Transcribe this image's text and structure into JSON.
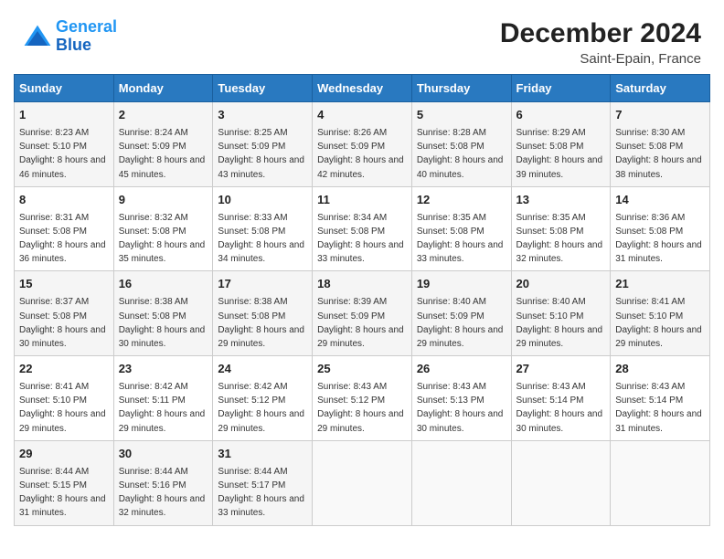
{
  "header": {
    "logo_line1": "General",
    "logo_line2": "Blue",
    "month_year": "December 2024",
    "location": "Saint-Epain, France"
  },
  "weekdays": [
    "Sunday",
    "Monday",
    "Tuesday",
    "Wednesday",
    "Thursday",
    "Friday",
    "Saturday"
  ],
  "weeks": [
    [
      {
        "day": "1",
        "sunrise": "Sunrise: 8:23 AM",
        "sunset": "Sunset: 5:10 PM",
        "daylight": "Daylight: 8 hours and 46 minutes."
      },
      {
        "day": "2",
        "sunrise": "Sunrise: 8:24 AM",
        "sunset": "Sunset: 5:09 PM",
        "daylight": "Daylight: 8 hours and 45 minutes."
      },
      {
        "day": "3",
        "sunrise": "Sunrise: 8:25 AM",
        "sunset": "Sunset: 5:09 PM",
        "daylight": "Daylight: 8 hours and 43 minutes."
      },
      {
        "day": "4",
        "sunrise": "Sunrise: 8:26 AM",
        "sunset": "Sunset: 5:09 PM",
        "daylight": "Daylight: 8 hours and 42 minutes."
      },
      {
        "day": "5",
        "sunrise": "Sunrise: 8:28 AM",
        "sunset": "Sunset: 5:08 PM",
        "daylight": "Daylight: 8 hours and 40 minutes."
      },
      {
        "day": "6",
        "sunrise": "Sunrise: 8:29 AM",
        "sunset": "Sunset: 5:08 PM",
        "daylight": "Daylight: 8 hours and 39 minutes."
      },
      {
        "day": "7",
        "sunrise": "Sunrise: 8:30 AM",
        "sunset": "Sunset: 5:08 PM",
        "daylight": "Daylight: 8 hours and 38 minutes."
      }
    ],
    [
      {
        "day": "8",
        "sunrise": "Sunrise: 8:31 AM",
        "sunset": "Sunset: 5:08 PM",
        "daylight": "Daylight: 8 hours and 36 minutes."
      },
      {
        "day": "9",
        "sunrise": "Sunrise: 8:32 AM",
        "sunset": "Sunset: 5:08 PM",
        "daylight": "Daylight: 8 hours and 35 minutes."
      },
      {
        "day": "10",
        "sunrise": "Sunrise: 8:33 AM",
        "sunset": "Sunset: 5:08 PM",
        "daylight": "Daylight: 8 hours and 34 minutes."
      },
      {
        "day": "11",
        "sunrise": "Sunrise: 8:34 AM",
        "sunset": "Sunset: 5:08 PM",
        "daylight": "Daylight: 8 hours and 33 minutes."
      },
      {
        "day": "12",
        "sunrise": "Sunrise: 8:35 AM",
        "sunset": "Sunset: 5:08 PM",
        "daylight": "Daylight: 8 hours and 33 minutes."
      },
      {
        "day": "13",
        "sunrise": "Sunrise: 8:35 AM",
        "sunset": "Sunset: 5:08 PM",
        "daylight": "Daylight: 8 hours and 32 minutes."
      },
      {
        "day": "14",
        "sunrise": "Sunrise: 8:36 AM",
        "sunset": "Sunset: 5:08 PM",
        "daylight": "Daylight: 8 hours and 31 minutes."
      }
    ],
    [
      {
        "day": "15",
        "sunrise": "Sunrise: 8:37 AM",
        "sunset": "Sunset: 5:08 PM",
        "daylight": "Daylight: 8 hours and 30 minutes."
      },
      {
        "day": "16",
        "sunrise": "Sunrise: 8:38 AM",
        "sunset": "Sunset: 5:08 PM",
        "daylight": "Daylight: 8 hours and 30 minutes."
      },
      {
        "day": "17",
        "sunrise": "Sunrise: 8:38 AM",
        "sunset": "Sunset: 5:08 PM",
        "daylight": "Daylight: 8 hours and 29 minutes."
      },
      {
        "day": "18",
        "sunrise": "Sunrise: 8:39 AM",
        "sunset": "Sunset: 5:09 PM",
        "daylight": "Daylight: 8 hours and 29 minutes."
      },
      {
        "day": "19",
        "sunrise": "Sunrise: 8:40 AM",
        "sunset": "Sunset: 5:09 PM",
        "daylight": "Daylight: 8 hours and 29 minutes."
      },
      {
        "day": "20",
        "sunrise": "Sunrise: 8:40 AM",
        "sunset": "Sunset: 5:10 PM",
        "daylight": "Daylight: 8 hours and 29 minutes."
      },
      {
        "day": "21",
        "sunrise": "Sunrise: 8:41 AM",
        "sunset": "Sunset: 5:10 PM",
        "daylight": "Daylight: 8 hours and 29 minutes."
      }
    ],
    [
      {
        "day": "22",
        "sunrise": "Sunrise: 8:41 AM",
        "sunset": "Sunset: 5:10 PM",
        "daylight": "Daylight: 8 hours and 29 minutes."
      },
      {
        "day": "23",
        "sunrise": "Sunrise: 8:42 AM",
        "sunset": "Sunset: 5:11 PM",
        "daylight": "Daylight: 8 hours and 29 minutes."
      },
      {
        "day": "24",
        "sunrise": "Sunrise: 8:42 AM",
        "sunset": "Sunset: 5:12 PM",
        "daylight": "Daylight: 8 hours and 29 minutes."
      },
      {
        "day": "25",
        "sunrise": "Sunrise: 8:43 AM",
        "sunset": "Sunset: 5:12 PM",
        "daylight": "Daylight: 8 hours and 29 minutes."
      },
      {
        "day": "26",
        "sunrise": "Sunrise: 8:43 AM",
        "sunset": "Sunset: 5:13 PM",
        "daylight": "Daylight: 8 hours and 30 minutes."
      },
      {
        "day": "27",
        "sunrise": "Sunrise: 8:43 AM",
        "sunset": "Sunset: 5:14 PM",
        "daylight": "Daylight: 8 hours and 30 minutes."
      },
      {
        "day": "28",
        "sunrise": "Sunrise: 8:43 AM",
        "sunset": "Sunset: 5:14 PM",
        "daylight": "Daylight: 8 hours and 31 minutes."
      }
    ],
    [
      {
        "day": "29",
        "sunrise": "Sunrise: 8:44 AM",
        "sunset": "Sunset: 5:15 PM",
        "daylight": "Daylight: 8 hours and 31 minutes."
      },
      {
        "day": "30",
        "sunrise": "Sunrise: 8:44 AM",
        "sunset": "Sunset: 5:16 PM",
        "daylight": "Daylight: 8 hours and 32 minutes."
      },
      {
        "day": "31",
        "sunrise": "Sunrise: 8:44 AM",
        "sunset": "Sunset: 5:17 PM",
        "daylight": "Daylight: 8 hours and 33 minutes."
      },
      null,
      null,
      null,
      null
    ]
  ]
}
